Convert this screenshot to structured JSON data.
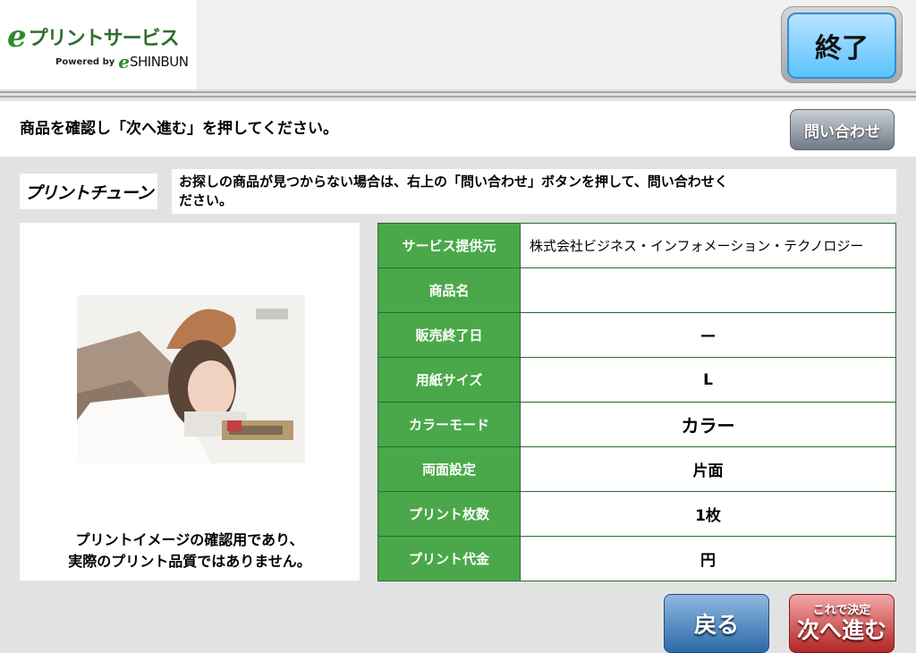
{
  "header": {
    "logo_e": "e",
    "logo_text": "プリントサービス",
    "logo_powered": "Powered by",
    "logo_e2": "e",
    "logo_shinbun": "SHINBUN",
    "end_button": "終了"
  },
  "instruction": {
    "text": "商品を確認し「次へ進む」を押してください。",
    "inquiry_button": "問い合わせ"
  },
  "brand": {
    "logo_text": "プリントチューン"
  },
  "notice": {
    "line1": "お探しの商品が見つからない場合は、右上の「問い合わせ」ボタンを押して、問い合わせく",
    "line2": "ださい。"
  },
  "preview": {
    "caption_line1": "プリントイメージの確認用であり、",
    "caption_line2": "実際のプリント品質ではありません。"
  },
  "details": {
    "rows": [
      {
        "label": "サービス提供元",
        "value": "株式会社ビジネス・インフォメーション・テクノロジー"
      },
      {
        "label": "商品名",
        "value": ""
      },
      {
        "label": "販売終了日",
        "value": "—"
      },
      {
        "label": "用紙サイズ",
        "value": "L"
      },
      {
        "label": "カラーモード",
        "value": "カラー"
      },
      {
        "label": "両面設定",
        "value": "片面"
      },
      {
        "label": "プリント枚数",
        "value": "1枚"
      },
      {
        "label": "プリント代金",
        "value": "円"
      }
    ]
  },
  "footer": {
    "back_button": "戻る",
    "next_small": "これで決定",
    "next_big": "次へ進む"
  },
  "colors": {
    "table_header": "#4aa84a",
    "end_button": "#5cc2ff",
    "back_button": "#2c6aa8",
    "next_button": "#b32626",
    "inquiry_button": "#6f7a86"
  }
}
